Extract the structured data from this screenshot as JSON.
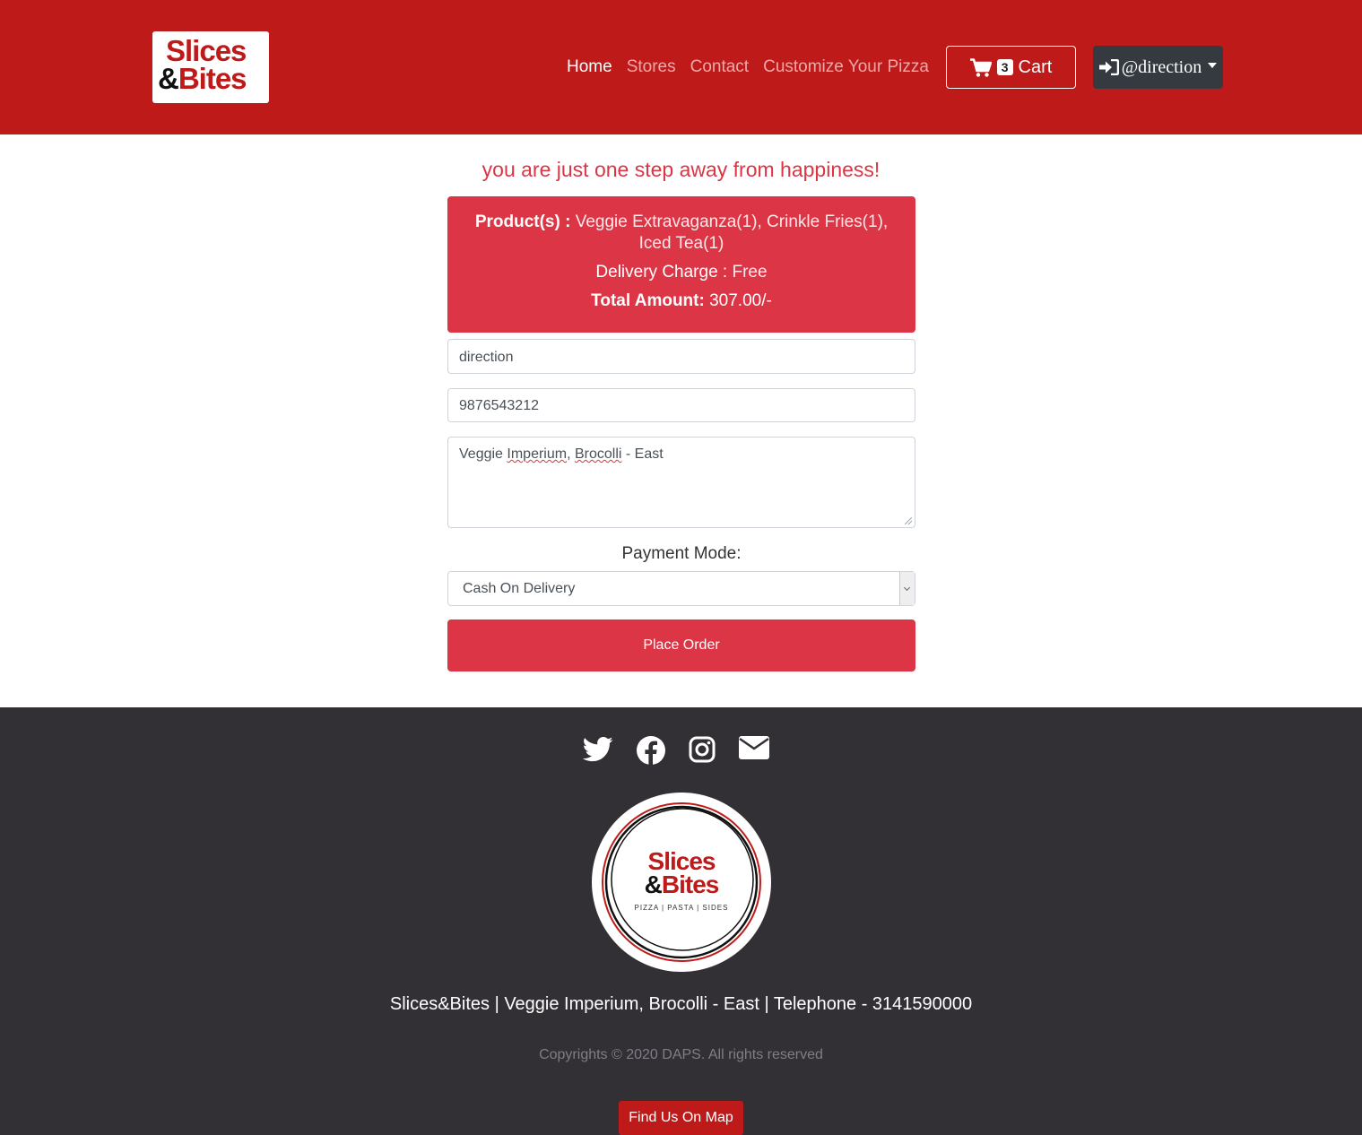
{
  "navbar": {
    "logo_line1": "Slices",
    "logo_amp": "&",
    "logo_line2": "Bites",
    "links": [
      "Home",
      "Stores",
      "Contact",
      "Customize Your Pizza"
    ],
    "cart_count": "3",
    "cart_label": "Cart",
    "user_label": "@direction"
  },
  "main": {
    "tagline": "you are just one step away from happiness!",
    "summary": {
      "products_key": "Product(s) :",
      "products_value": "Veggie Extravaganza(1), Crinkle Fries(1), Iced Tea(1)",
      "delivery_key": "Delivery Charge :",
      "delivery_value": "Free",
      "total_key": "Total Amount:",
      "total_value": "307.00/-"
    },
    "name_value": "direction",
    "phone_value": "9876543212",
    "address_pre": "Veggie ",
    "address_word1": "Imperium",
    "address_mid": ", ",
    "address_word2": "Brocolli",
    "address_post": " - East",
    "payment_label": "Payment Mode:",
    "payment_selected": "Cash On Delivery",
    "place_order_label": "Place Order"
  },
  "footer": {
    "social_icons": [
      "twitter-icon",
      "facebook-icon",
      "instagram-icon",
      "envelope-icon"
    ],
    "circle_logo_line1": "Slices",
    "circle_logo_amp": "&",
    "circle_logo_line2": "Bites",
    "circle_logo_tagline": "PIZZA | PASTA | SIDES",
    "info": "Slices&Bites | Veggie Imperium, Brocolli - East | Telephone - 3141590000",
    "copyright": "Copyrights © 2020 DAPS. All rights reserved",
    "map_button": "Find Us On Map"
  },
  "colors": {
    "brand_red": "#bf1a1a",
    "accent_red": "#dc3545",
    "footer_bg": "#333035",
    "user_button_bg": "#343a40"
  }
}
